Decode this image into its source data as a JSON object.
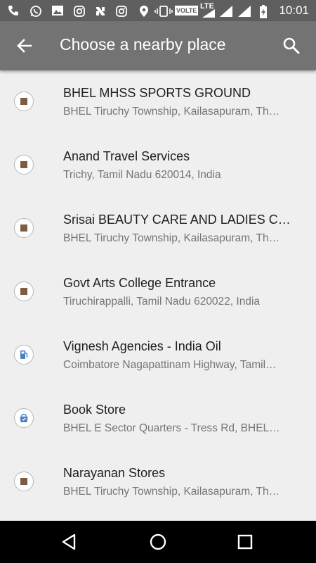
{
  "status_bar": {
    "time": "10:01",
    "volte_label": "VOLTE",
    "lte_label": "LTE"
  },
  "app_bar": {
    "title": "Choose a nearby place",
    "back_icon": "arrow-back-icon",
    "search_icon": "search-icon"
  },
  "places": [
    {
      "name": "BHEL MHSS SPORTS GROUND",
      "address": "BHEL Tiruchy Township, Kailasapuram, Th…",
      "icon": "place-pin-icon"
    },
    {
      "name": "Anand Travel Services",
      "address": "Trichy, Tamil Nadu 620014, India",
      "icon": "place-pin-icon"
    },
    {
      "name": "Srisai BEAUTY CARE AND LADIES C…",
      "address": "BHEL Tiruchy Township, Kailasapuram, Th…",
      "icon": "place-pin-icon"
    },
    {
      "name": "Govt Arts College Entrance",
      "address": "Tiruchirappalli, Tamil Nadu 620022, India",
      "icon": "place-pin-icon"
    },
    {
      "name": "Vignesh Agencies - India Oil",
      "address": "Coimbatore Nagapattinam Highway, Tamil…",
      "icon": "gas-station-icon"
    },
    {
      "name": "Book Store",
      "address": "BHEL E Sector Quarters - Tress Rd, BHEL…",
      "icon": "shopping-bag-icon"
    },
    {
      "name": "Narayanan Stores",
      "address": "BHEL Tiruchy Township, Kailasapuram, Th…",
      "icon": "place-pin-icon"
    }
  ],
  "colors": {
    "status_bar_bg": "#5f5f5f",
    "app_bar_bg": "#737373",
    "list_bg": "#efefef",
    "pin_square": "#7e5c44",
    "poi_blue": "#4a7fc1"
  }
}
